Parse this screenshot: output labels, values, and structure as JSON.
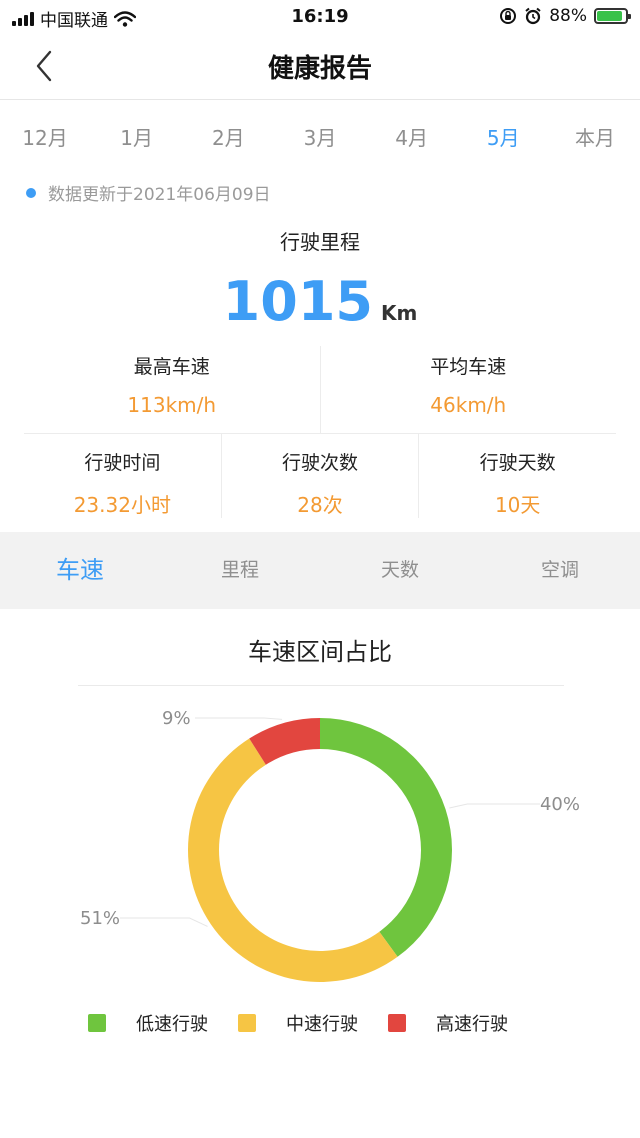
{
  "status_bar": {
    "carrier": "中国联通",
    "time": "16:19",
    "battery": "88%",
    "icons": [
      "signal-icon",
      "wifi-icon",
      "rotation-lock-icon",
      "alarm-icon",
      "battery-icon"
    ]
  },
  "nav": {
    "title": "健康报告",
    "back_icon": "chevron-left-icon"
  },
  "month_tabs": {
    "items": [
      "12月",
      "1月",
      "2月",
      "3月",
      "4月",
      "5月",
      "本月"
    ],
    "active": "5月"
  },
  "update_text": "数据更新于2021年06月09日",
  "mileage": {
    "label": "行驶里程",
    "value": "1015",
    "unit": "Km"
  },
  "stats": {
    "max_speed": {
      "label": "最高车速",
      "value": "113km/h"
    },
    "avg_speed": {
      "label": "平均车速",
      "value": "46km/h"
    },
    "drive_time": {
      "label": "行驶时间",
      "value": "23.32小时"
    },
    "drive_count": {
      "label": "行驶次数",
      "value": "28次"
    },
    "drive_days": {
      "label": "行驶天数",
      "value": "10天"
    }
  },
  "metric_tabs": {
    "items": [
      "车速",
      "里程",
      "天数",
      "空调"
    ],
    "active": "车速"
  },
  "colors": {
    "accent": "#3e9df5",
    "value_orange": "#f39a33",
    "low_speed": "#6fc53e",
    "mid_speed": "#f6c544",
    "high_speed": "#e2463f"
  },
  "chart_data": {
    "type": "pie",
    "style": "donut",
    "title": "车速区间占比",
    "series": [
      {
        "name": "低速行驶",
        "value": 40,
        "label": "40%",
        "color": "#6fc53e"
      },
      {
        "name": "中速行驶",
        "value": 51,
        "label": "51%",
        "color": "#f6c544"
      },
      {
        "name": "高速行驶",
        "value": 9,
        "label": "9%",
        "color": "#e2463f"
      }
    ],
    "legend_position": "bottom"
  }
}
